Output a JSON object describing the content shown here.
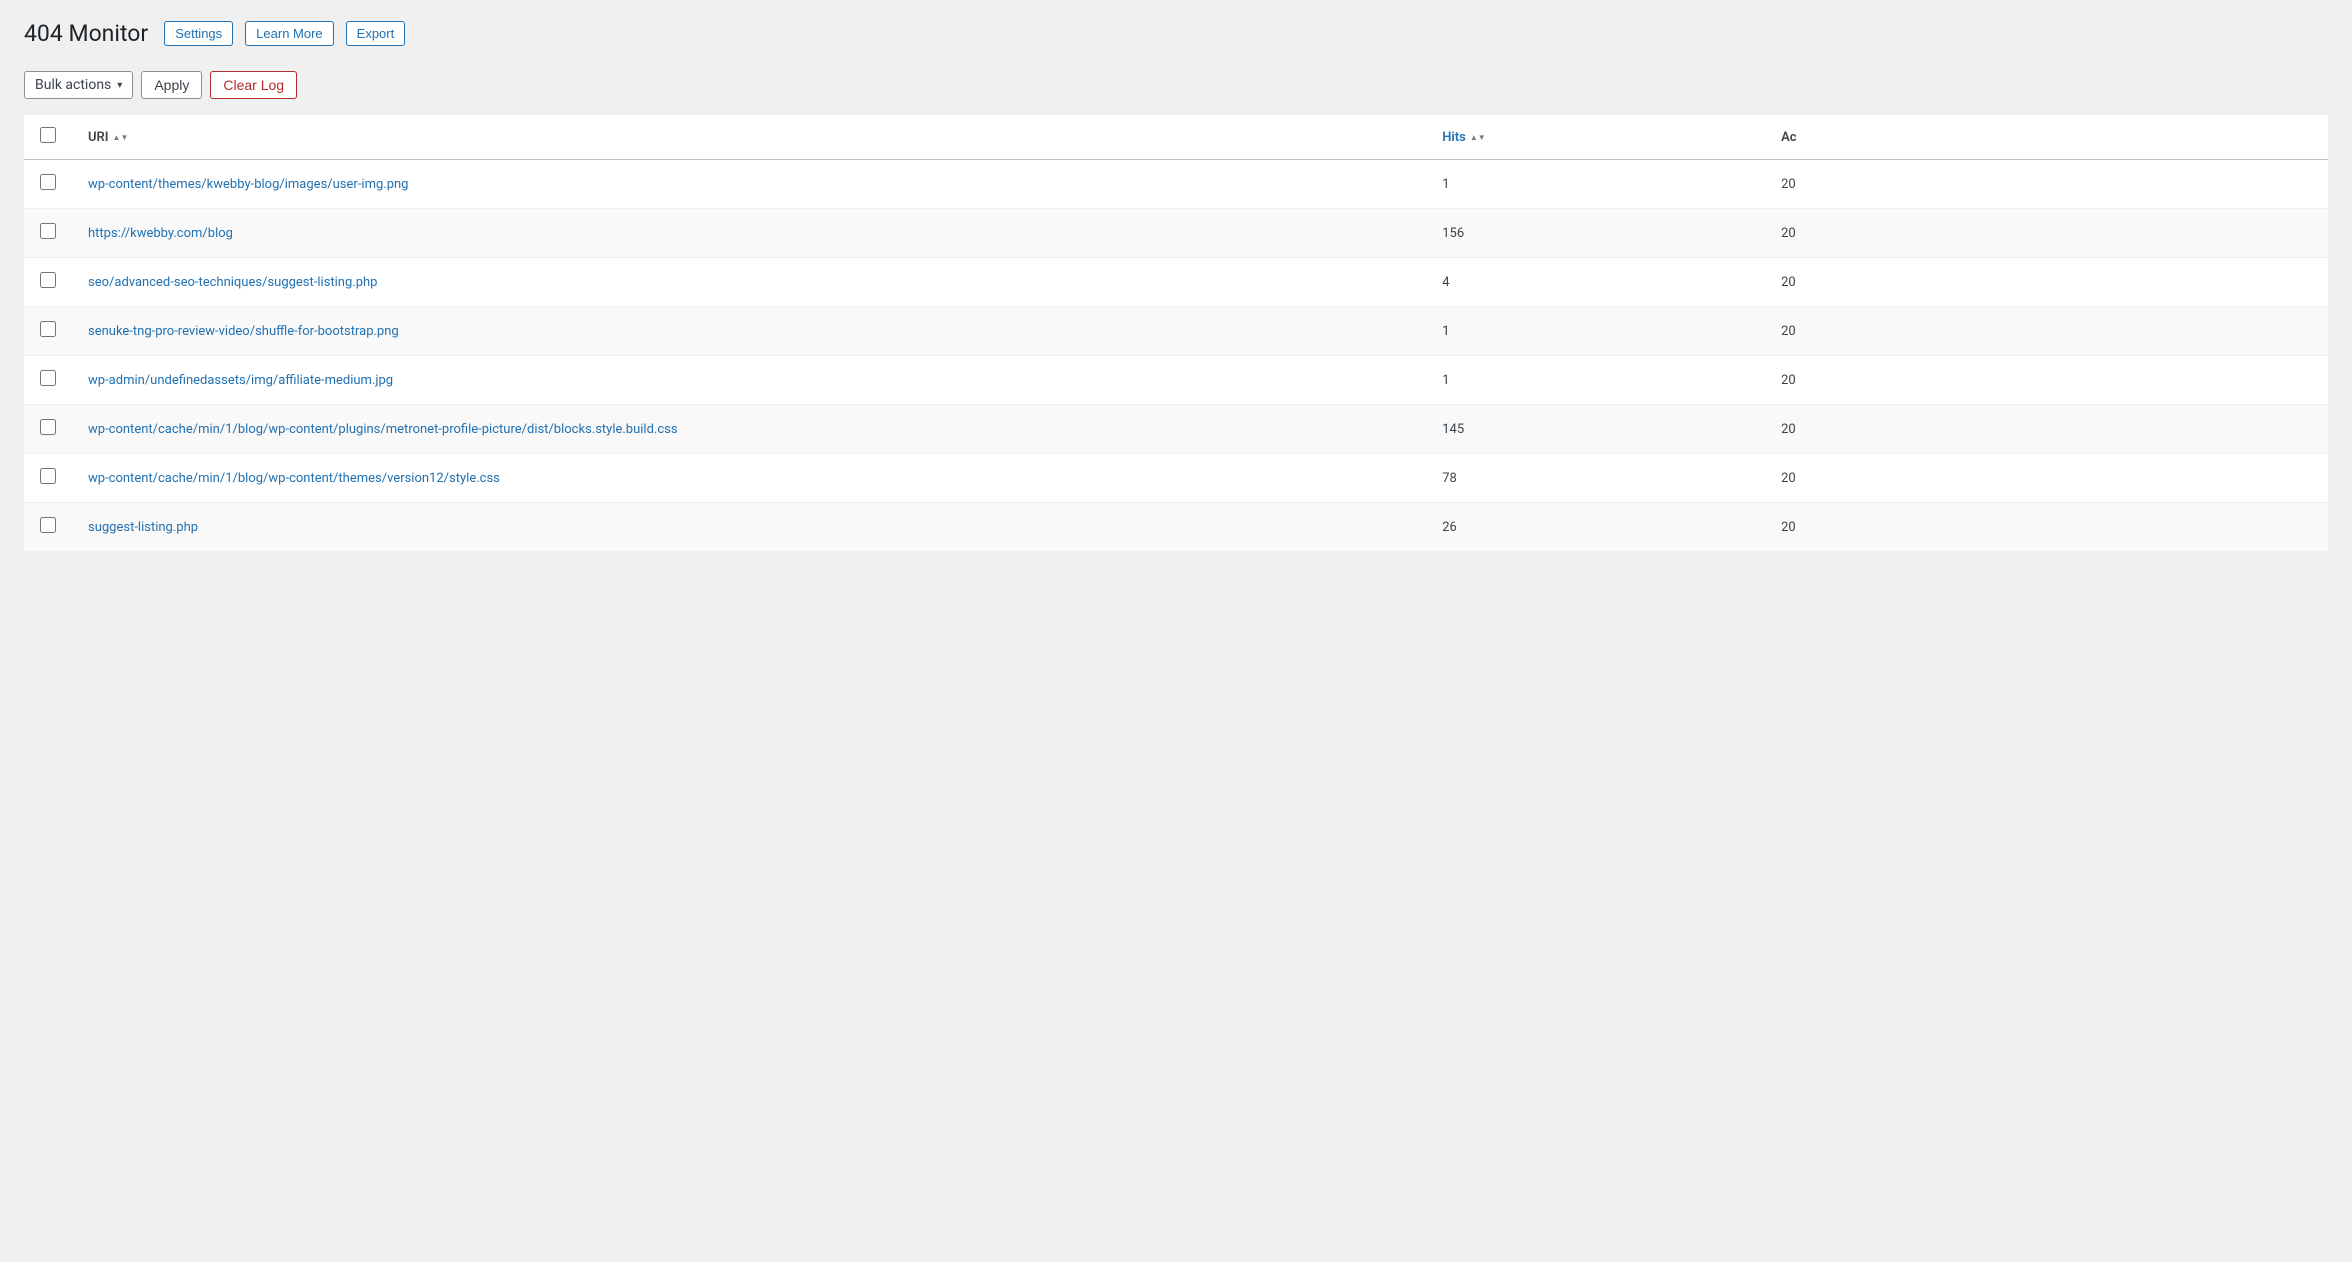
{
  "header": {
    "title": "404 Monitor",
    "buttons": [
      {
        "id": "settings",
        "label": "Settings"
      },
      {
        "id": "learn-more",
        "label": "Learn More"
      },
      {
        "id": "export",
        "label": "Export"
      }
    ]
  },
  "toolbar": {
    "bulk_actions_label": "Bulk actions",
    "apply_label": "Apply",
    "clear_log_label": "Clear Log"
  },
  "table": {
    "columns": [
      {
        "id": "uri",
        "label": "URI",
        "sortable": true
      },
      {
        "id": "hits",
        "label": "Hits",
        "sortable": true
      },
      {
        "id": "actions",
        "label": "Ac",
        "sortable": false
      }
    ],
    "rows": [
      {
        "id": 1,
        "uri": "wp-content/themes/kwebby-blog/images/user-img.png",
        "hits": "1",
        "actions": "20"
      },
      {
        "id": 2,
        "uri": "https://kwebby.com/blog",
        "hits": "156",
        "actions": "20"
      },
      {
        "id": 3,
        "uri": "seo/advanced-seo-techniques/suggest-listing.php",
        "hits": "4",
        "actions": "20"
      },
      {
        "id": 4,
        "uri": "senuke-tng-pro-review-video/shuffle-for-bootstrap.png",
        "hits": "1",
        "actions": "20"
      },
      {
        "id": 5,
        "uri": "wp-admin/undefinedassets/img/affiliate-medium.jpg",
        "hits": "1",
        "actions": "20"
      },
      {
        "id": 6,
        "uri": "wp-content/cache/min/1/blog/wp-content/plugins/metronet-profile-picture/dist/blocks.style.build.css",
        "hits": "145",
        "actions": "20"
      },
      {
        "id": 7,
        "uri": "wp-content/cache/min/1/blog/wp-content/themes/version12/style.css",
        "hits": "78",
        "actions": "20"
      },
      {
        "id": 8,
        "uri": "suggest-listing.php",
        "hits": "26",
        "actions": "20"
      }
    ]
  }
}
